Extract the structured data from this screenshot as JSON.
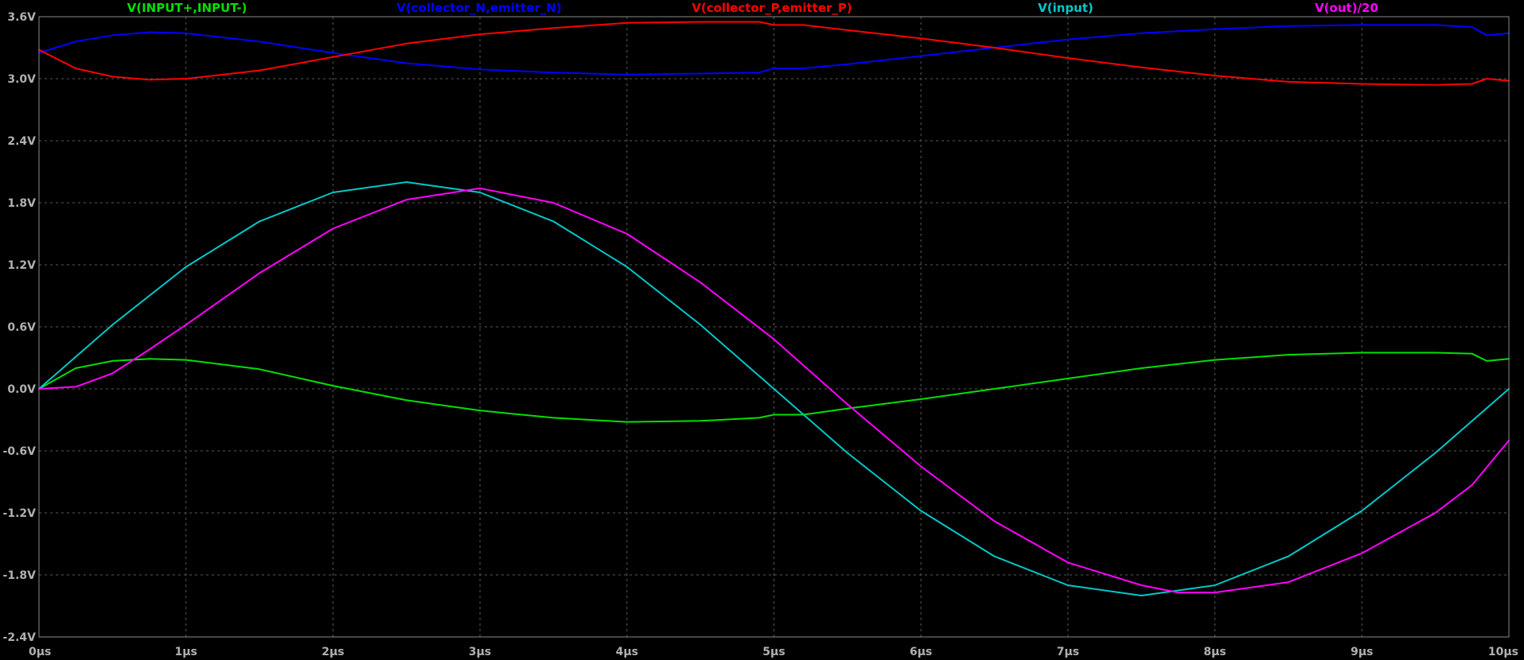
{
  "chart_data": {
    "type": "line",
    "xlabel": "",
    "ylabel": "",
    "xlim": [
      0,
      10
    ],
    "ylim": [
      -2.4,
      3.6
    ],
    "grid": true,
    "legend": "top",
    "background_color": "#000000",
    "x_ticks": [
      {
        "value": 0,
        "label": "0µs"
      },
      {
        "value": 1,
        "label": "1µs"
      },
      {
        "value": 2,
        "label": "2µs"
      },
      {
        "value": 3,
        "label": "3µs"
      },
      {
        "value": 4,
        "label": "4µs"
      },
      {
        "value": 5,
        "label": "5µs"
      },
      {
        "value": 6,
        "label": "6µs"
      },
      {
        "value": 7,
        "label": "7µs"
      },
      {
        "value": 8,
        "label": "8µs"
      },
      {
        "value": 9,
        "label": "9µs"
      },
      {
        "value": 10,
        "label": "10µs"
      }
    ],
    "y_ticks": [
      {
        "value": 3.6,
        "label": "3.6V"
      },
      {
        "value": 3.0,
        "label": "3.0V"
      },
      {
        "value": 2.4,
        "label": "2.4V"
      },
      {
        "value": 1.8,
        "label": "1.8V"
      },
      {
        "value": 1.2,
        "label": "1.2V"
      },
      {
        "value": 0.6,
        "label": "0.6V"
      },
      {
        "value": 0.0,
        "label": "0.0V"
      },
      {
        "value": -0.6,
        "label": "-0.6V"
      },
      {
        "value": -1.2,
        "label": "-1.2V"
      },
      {
        "value": -1.8,
        "label": "-1.8V"
      },
      {
        "value": -2.4,
        "label": "-2.4V"
      }
    ],
    "series": [
      {
        "name": "V(INPUT+,INPUT-)",
        "color": "#00e000",
        "x": [
          0,
          0.25,
          0.5,
          0.75,
          1.0,
          1.5,
          2.0,
          2.5,
          3.0,
          3.5,
          4.0,
          4.5,
          4.9,
          5.0,
          5.2,
          5.5,
          6.0,
          6.5,
          7.0,
          7.5,
          8.0,
          8.5,
          9.0,
          9.5,
          9.75,
          9.85,
          10.0
        ],
        "y": [
          0.0,
          0.2,
          0.27,
          0.29,
          0.28,
          0.19,
          0.03,
          -0.11,
          -0.21,
          -0.28,
          -0.32,
          -0.31,
          -0.28,
          -0.25,
          -0.25,
          -0.19,
          -0.1,
          0.0,
          0.1,
          0.2,
          0.28,
          0.33,
          0.35,
          0.35,
          0.34,
          0.27,
          0.29
        ]
      },
      {
        "name": "V(collector_N,emitter_N)",
        "color": "#0000ff",
        "x": [
          0,
          0.25,
          0.5,
          0.75,
          1.0,
          1.5,
          2.0,
          2.5,
          3.0,
          3.5,
          4.0,
          4.5,
          4.9,
          5.0,
          5.2,
          5.5,
          6.0,
          6.5,
          7.0,
          7.5,
          8.0,
          8.5,
          9.0,
          9.5,
          9.75,
          9.85,
          10.0
        ],
        "y": [
          3.25,
          3.36,
          3.42,
          3.45,
          3.44,
          3.36,
          3.25,
          3.15,
          3.09,
          3.06,
          3.04,
          3.05,
          3.06,
          3.1,
          3.1,
          3.14,
          3.22,
          3.3,
          3.38,
          3.44,
          3.48,
          3.51,
          3.52,
          3.52,
          3.5,
          3.42,
          3.44
        ]
      },
      {
        "name": "V(collector_P,emitter_P)",
        "color": "#ff0000",
        "x": [
          0,
          0.25,
          0.5,
          0.75,
          1.0,
          1.5,
          2.0,
          2.5,
          3.0,
          3.5,
          4.0,
          4.5,
          4.9,
          5.0,
          5.2,
          5.5,
          6.0,
          6.5,
          7.0,
          7.5,
          8.0,
          8.5,
          9.0,
          9.5,
          9.75,
          9.85,
          10.0
        ],
        "y": [
          3.28,
          3.1,
          3.02,
          2.99,
          3.0,
          3.08,
          3.21,
          3.34,
          3.43,
          3.49,
          3.54,
          3.55,
          3.55,
          3.52,
          3.52,
          3.47,
          3.39,
          3.3,
          3.2,
          3.11,
          3.03,
          2.97,
          2.95,
          2.94,
          2.95,
          3.0,
          2.98
        ]
      },
      {
        "name": "V(input)",
        "color": "#00c8c8",
        "x": [
          0,
          0.5,
          1.0,
          1.5,
          2.0,
          2.5,
          3.0,
          3.5,
          4.0,
          4.5,
          5.0,
          5.5,
          6.0,
          6.5,
          7.0,
          7.5,
          8.0,
          8.5,
          9.0,
          9.5,
          10.0
        ],
        "y": [
          0.0,
          0.62,
          1.18,
          1.62,
          1.9,
          2.0,
          1.9,
          1.62,
          1.18,
          0.62,
          0.0,
          -0.62,
          -1.18,
          -1.62,
          -1.9,
          -2.0,
          -1.9,
          -1.62,
          -1.18,
          -0.62,
          0.0
        ]
      },
      {
        "name": "V(out)/20",
        "color": "#ff00ff",
        "x": [
          0,
          0.25,
          0.5,
          0.75,
          1.0,
          1.5,
          2.0,
          2.5,
          3.0,
          3.5,
          4.0,
          4.5,
          5.0,
          5.5,
          6.0,
          6.5,
          7.0,
          7.5,
          7.75,
          8.0,
          8.5,
          9.0,
          9.5,
          9.75,
          10.0
        ],
        "y": [
          0.0,
          0.02,
          0.15,
          0.38,
          0.62,
          1.12,
          1.55,
          1.83,
          1.94,
          1.8,
          1.5,
          1.03,
          0.48,
          -0.15,
          -0.75,
          -1.28,
          -1.68,
          -1.9,
          -1.97,
          -1.97,
          -1.87,
          -1.59,
          -1.2,
          -0.93,
          -0.5
        ]
      }
    ]
  }
}
